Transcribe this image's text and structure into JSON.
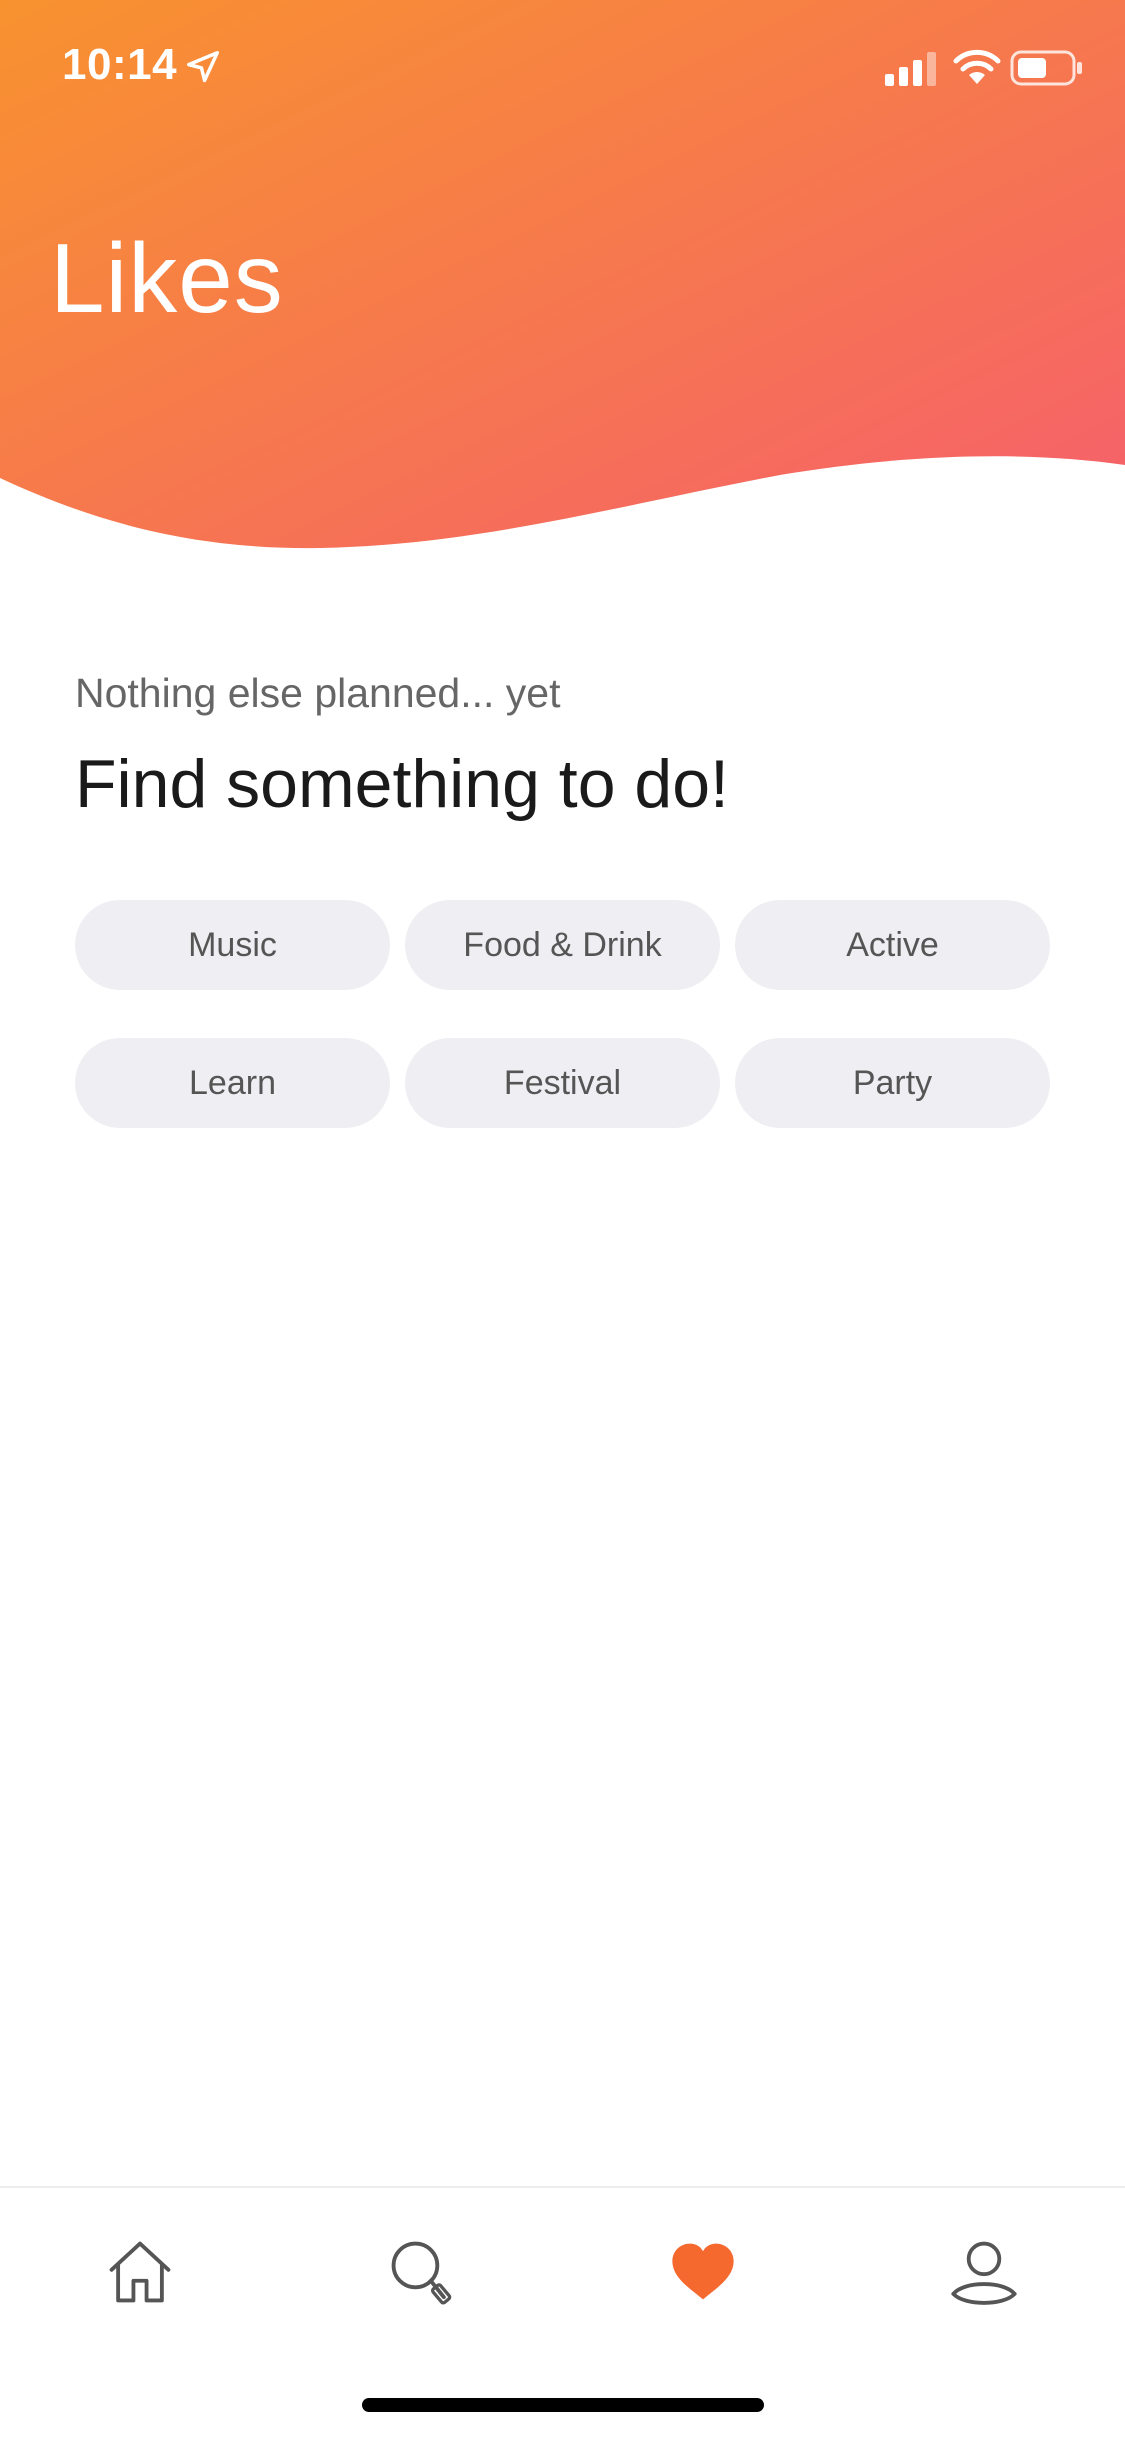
{
  "status_bar": {
    "time": "10:14"
  },
  "header": {
    "title": "Likes",
    "gradient_start": "#f8922f",
    "gradient_end": "#f55f6c"
  },
  "empty_state": {
    "subtitle": "Nothing else planned... yet",
    "headline": "Find something to do!"
  },
  "categories": [
    {
      "label": "Music"
    },
    {
      "label": "Food & Drink"
    },
    {
      "label": "Active"
    },
    {
      "label": "Learn"
    },
    {
      "label": "Festival"
    },
    {
      "label": "Party"
    }
  ],
  "tab_bar": {
    "tabs": [
      {
        "icon": "home-icon",
        "active": false
      },
      {
        "icon": "search-icon",
        "active": false
      },
      {
        "icon": "heart-icon",
        "active": true
      },
      {
        "icon": "profile-icon",
        "active": false
      }
    ],
    "active_color": "#f5692f",
    "inactive_color": "#555555"
  }
}
